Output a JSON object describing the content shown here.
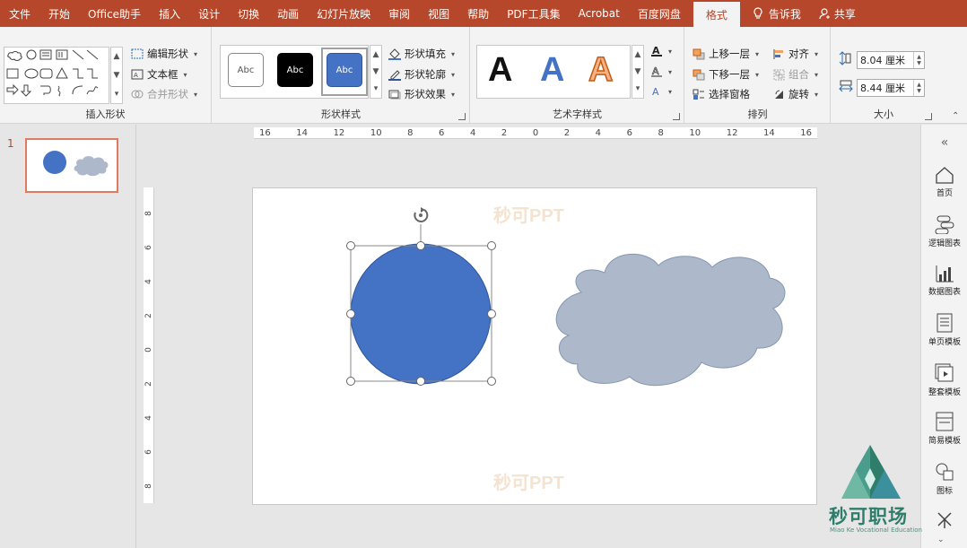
{
  "tabs": [
    "文件",
    "开始",
    "Office助手",
    "插入",
    "设计",
    "切换",
    "动画",
    "幻灯片放映",
    "审阅",
    "视图",
    "帮助",
    "PDF工具集",
    "Acrobat",
    "百度网盘",
    "格式"
  ],
  "active_tab": "格式",
  "tell_me": "告诉我",
  "share": "共享",
  "ribbon": {
    "insert_shapes": {
      "label": "插入形状",
      "edit_shape": "编辑形状",
      "text_box": "文本框",
      "merge_shapes": "合并形状"
    },
    "shape_styles": {
      "label": "形状样式",
      "swatch_text": "Abc",
      "fill": "形状填充",
      "outline": "形状轮廓",
      "effects": "形状效果"
    },
    "wordart": {
      "label": "艺术字样式",
      "letter": "A"
    },
    "arrange": {
      "label": "排列",
      "bring_forward": "上移一层",
      "send_backward": "下移一层",
      "selection_pane": "选择窗格",
      "align": "对齐",
      "group": "组合",
      "rotate": "旋转"
    },
    "size": {
      "label": "大小",
      "height": "8.04 厘米",
      "width": "8.44 厘米"
    }
  },
  "thumbnail": {
    "slide_number": "1"
  },
  "ruler": {
    "horizontal": [
      "16",
      "14",
      "12",
      "10",
      "8",
      "6",
      "4",
      "2",
      "0",
      "2",
      "4",
      "6",
      "8",
      "10",
      "12",
      "14",
      "16"
    ],
    "vertical": [
      "8",
      "6",
      "4",
      "2",
      "0",
      "2",
      "4",
      "6",
      "8"
    ]
  },
  "slide": {
    "watermark": "秒可PPT",
    "circle_color": "#4472c4",
    "cloud_color": "#adb9ca"
  },
  "sidebar": {
    "collapse": "«",
    "items": [
      "首页",
      "逻辑图表",
      "数据图表",
      "单页模板",
      "整套模板",
      "简易模板",
      "图标"
    ]
  },
  "brand": {
    "name": "秒可职场",
    "subtitle": "Miao Ke Vocational Education"
  },
  "colors": {
    "accent": "#b7472a"
  }
}
